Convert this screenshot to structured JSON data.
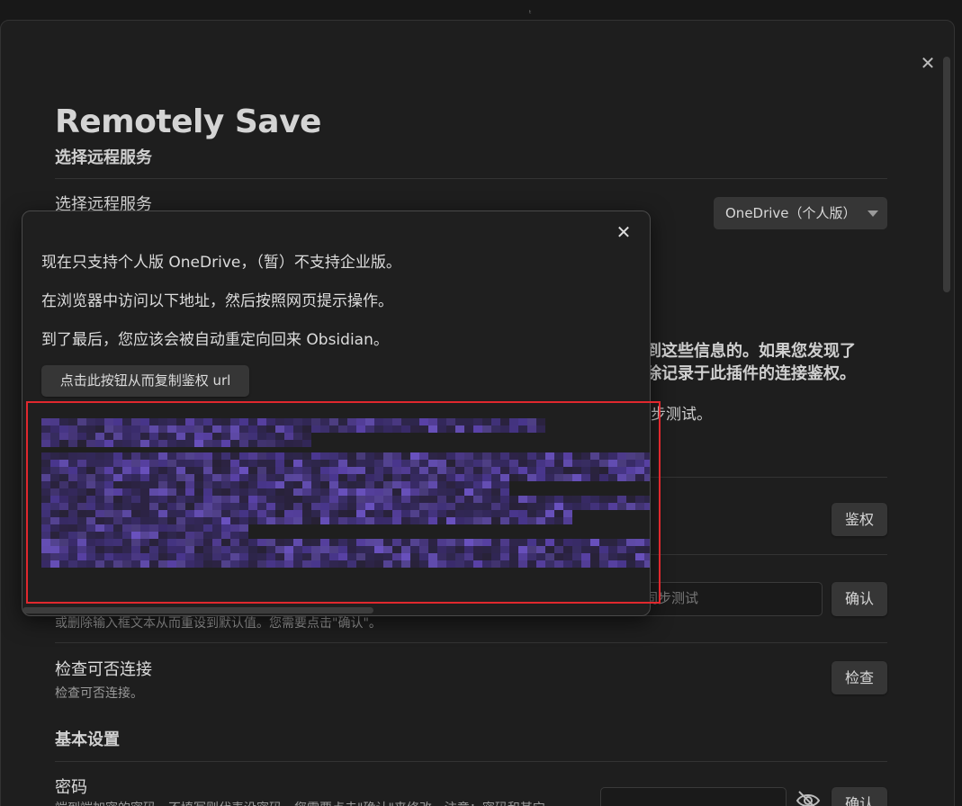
{
  "settings": {
    "title": "Remotely Save",
    "section_remote": "选择远程服务",
    "row_choose_label": "选择远程服务",
    "choose_value": "OneDrive（个人版）",
    "partial_bold_1": "到这些信息的。如果您发现了",
    "partial_bold_2": "除记录于此插件的连接鉴权。",
    "partial_plain": "步测试。",
    "auth_button": "鉴权",
    "input_placeholder": "同步测试",
    "confirm_button": "确认",
    "row_desc_partial": "或删除输入框文本从而重设到默认值。您需要点击\"确认\"。",
    "check_label": "检查可否连接",
    "check_desc": "检查可否连接。",
    "check_button": "检查",
    "section_basic": "基本设置",
    "password_label": "密码",
    "password_desc": "端到端加密的密码。不填写则代表没密码。您需要点击\"确认\"来修改。注意：密码和其它",
    "password_confirm": "确认"
  },
  "modal": {
    "line1": "现在只支持个人版 OneDrive，（暂）不支持企业版。",
    "line2": "在浏览器中访问以下地址，然后按照网页提示操作。",
    "line3": "到了最后，您应该会被自动重定向回来 Obsidian。",
    "copy_button": "点击此按钮从而复制鉴权 url"
  },
  "icons": {
    "close": "close-icon",
    "eye": "eye-off-icon",
    "caret": "chevron-down-icon"
  },
  "colors": {
    "background": "#1e1e1e",
    "highlight": "#e0282e",
    "blurred_url": "#5a3fa0"
  }
}
